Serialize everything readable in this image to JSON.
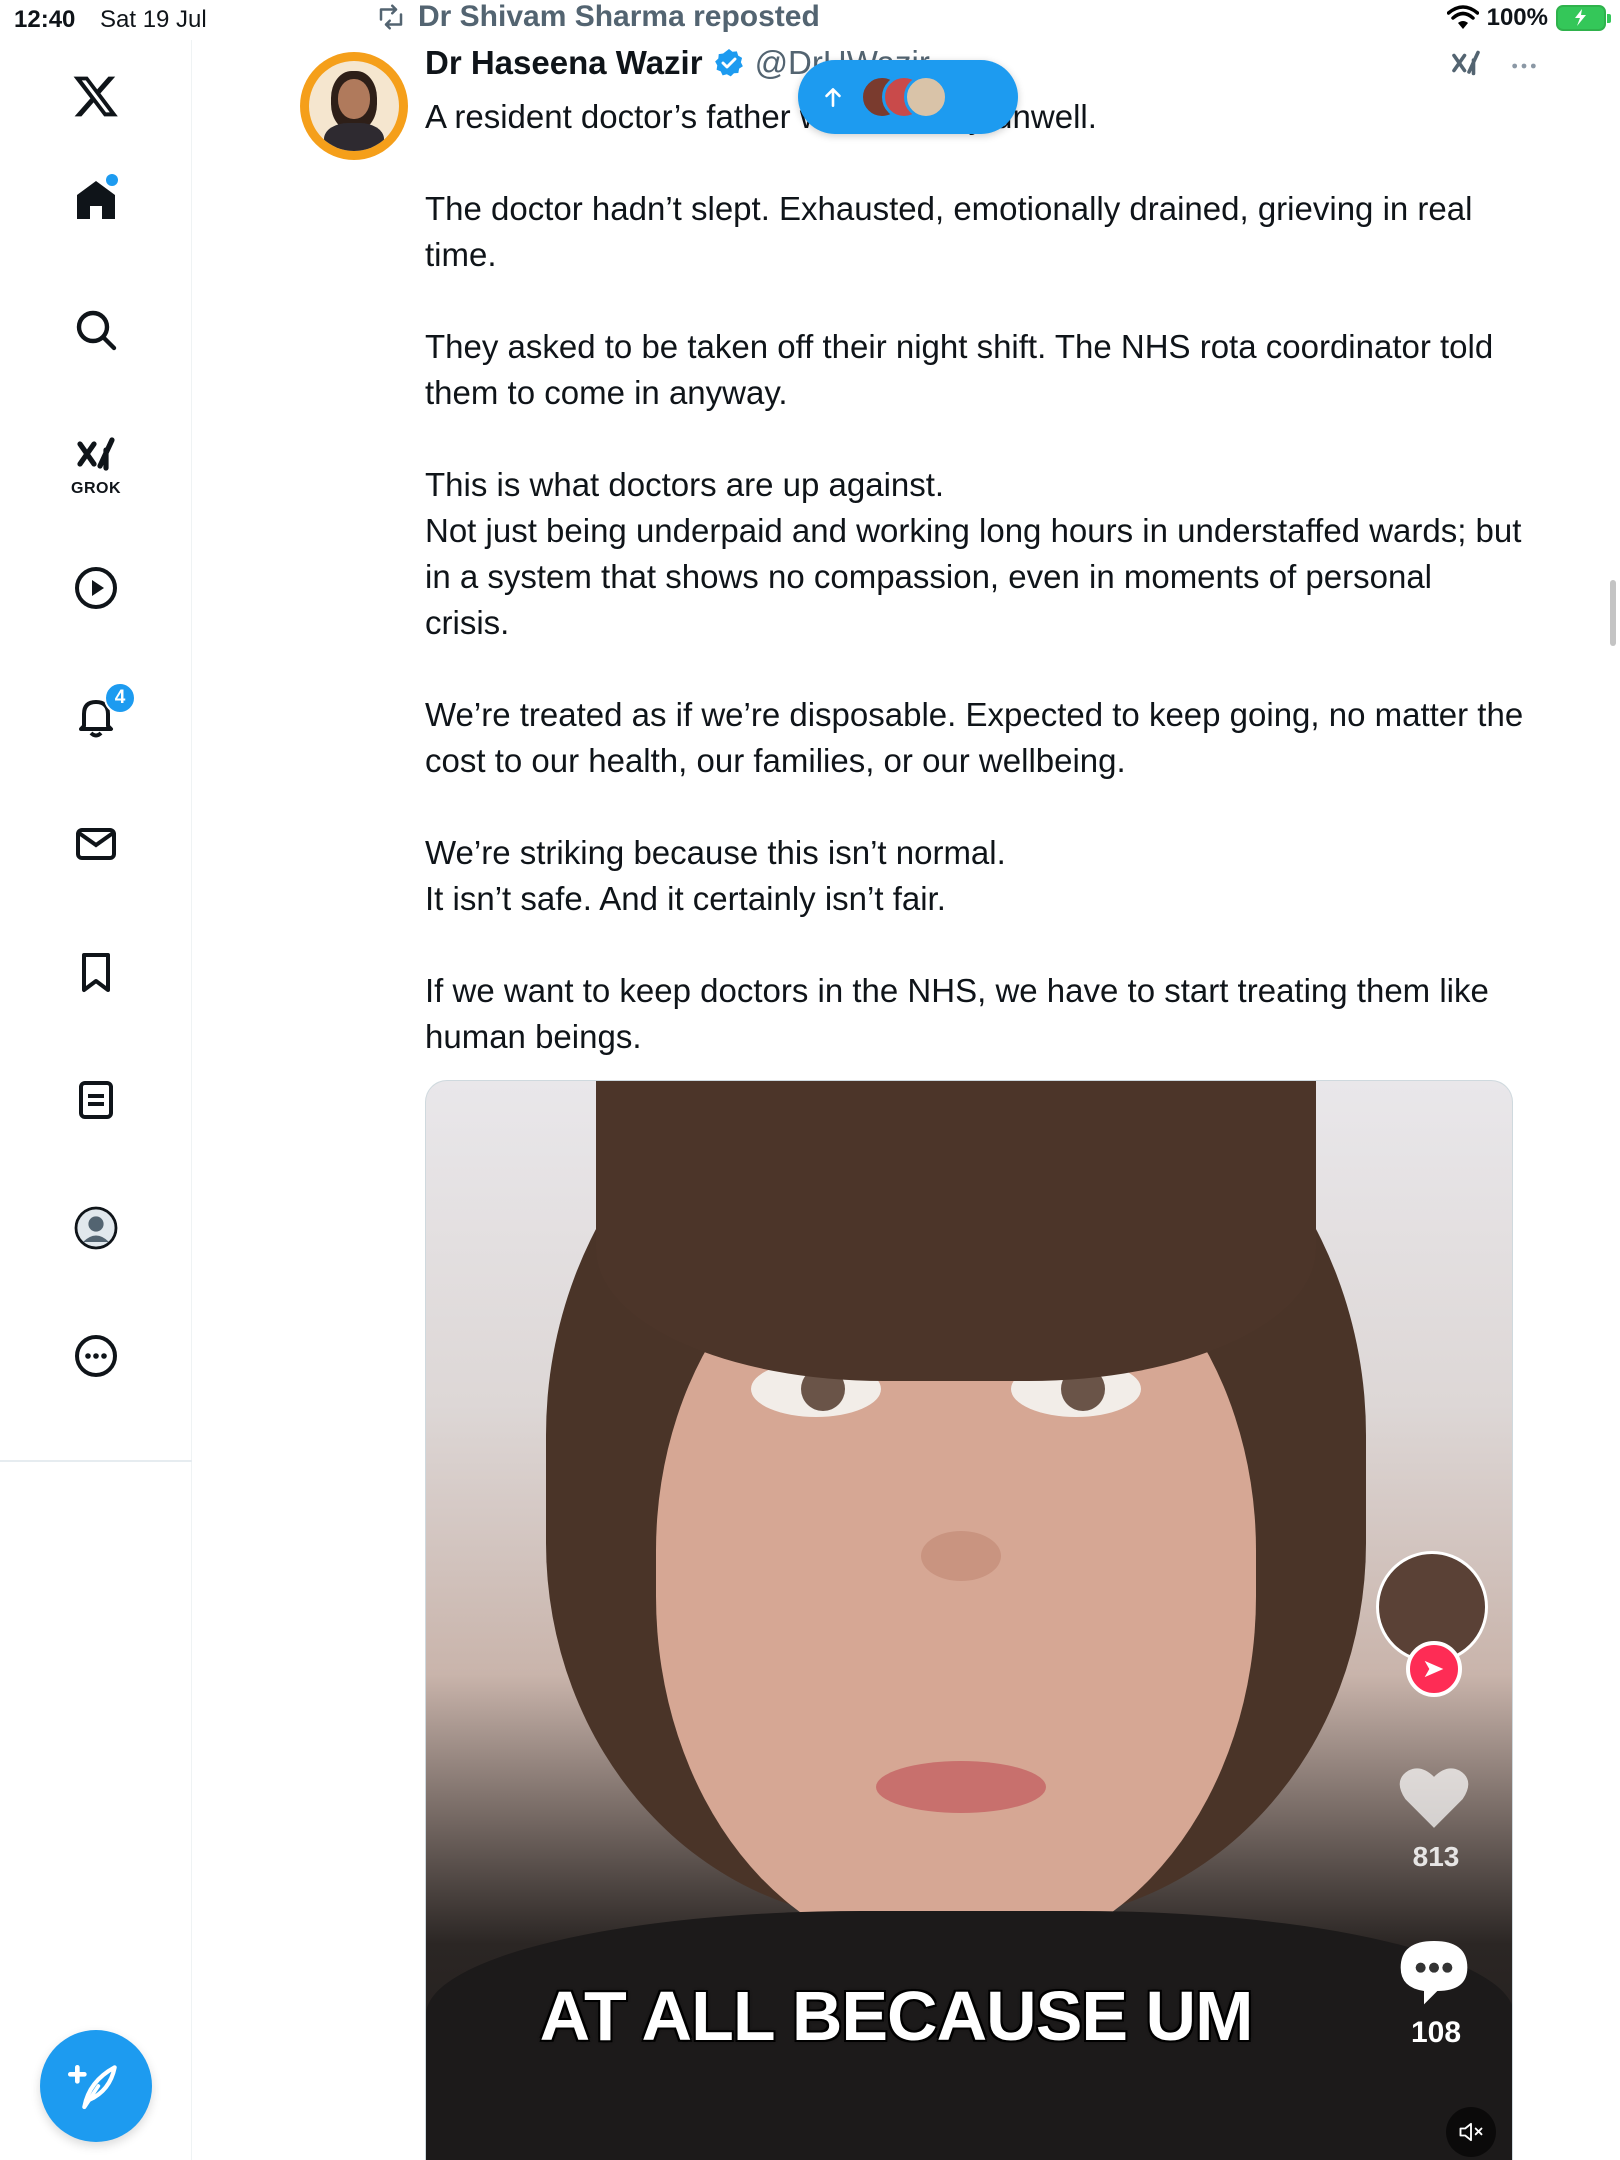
{
  "status_bar": {
    "time": "12:40",
    "date": "Sat 19 Jul",
    "battery": "100%"
  },
  "sidebar": {
    "items": [
      {
        "name": "x-logo-icon"
      },
      {
        "name": "home-icon",
        "has_dot": true
      },
      {
        "name": "search-icon"
      },
      {
        "name": "grok-icon",
        "label": "GROK"
      },
      {
        "name": "video-icon"
      },
      {
        "name": "notifications-icon",
        "badge": "4"
      },
      {
        "name": "messages-icon"
      },
      {
        "name": "bookmarks-icon"
      },
      {
        "name": "lists-icon"
      },
      {
        "name": "profile-icon"
      },
      {
        "name": "more-icon"
      }
    ],
    "compose_icon": "compose-post-icon",
    "accent_color": "#1d9bf0"
  },
  "post": {
    "repost_by": "Dr Shivam Sharma reposted",
    "author_name": "Dr Haseena Wazir",
    "author_handle": "@DrHWazir…",
    "verified": true,
    "paragraphs": [
      "A resident doctor’s father was critically unwell.",
      "The doctor hadn’t slept. Exhausted, emotionally drained, grieving in real time.",
      "They asked to be taken off their night shift. The NHS rota coordinator told them to come in anyway.",
      "This is what doctors are up against.\nNot just being underpaid and working long hours in understaffed wards; but in a system that shows no compassion, even in moments of personal crisis.",
      "We’re treated as if we’re disposable. Expected to keep going, no matter the cost to our health, our families, or our wellbeing.",
      "We’re striking because this isn’t normal.\nIt isn’t safe. And it certainly isn’t fair.",
      "If we want to keep doctors in the NHS, we have to start treating them like human beings."
    ],
    "video": {
      "caption": "AT ALL BECAUSE UM",
      "like_count": "813",
      "comment_count": "108"
    }
  },
  "new_posts_pill": {
    "icon": "arrow-up-icon"
  }
}
